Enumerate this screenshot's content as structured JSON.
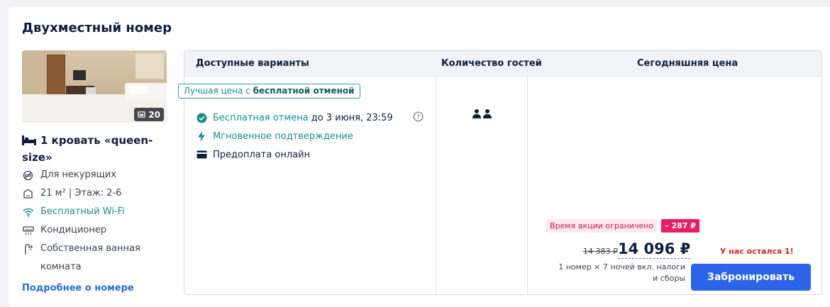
{
  "room": {
    "title": "Двухместный номер",
    "photo_count": "20",
    "bed": "1 кровать «queen-size»",
    "features": [
      {
        "icon": "no-smoking-icon",
        "label": "Для некурящих"
      },
      {
        "icon": "room-size-icon",
        "label": "21 м² | Этаж: 2-6"
      },
      {
        "icon": "wifi-icon",
        "label": "Бесплатный Wi-Fi"
      },
      {
        "icon": "air-conditioner-icon",
        "label": "Кондиционер"
      },
      {
        "icon": "shower-icon",
        "label": "Собственная ванная комната"
      }
    ],
    "more_link": "Подробнее о номере"
  },
  "table": {
    "headers": {
      "options": "Доступные варианты",
      "guests": "Количество гостей",
      "price": "Сегодняшняя цена"
    },
    "best_tag_prefix": "Лучшая цена с",
    "best_tag_bold": "бесплатной отменой",
    "options": {
      "free_cancel": "Бесплатная отмена",
      "free_cancel_until": "до 3 июня, 23:59",
      "instant_confirm": "Мгновенное подтверждение",
      "prepay": "Предоплата онлайн"
    },
    "price": {
      "promo_text": "Время акции ограничено",
      "discount": "– 287 ₽",
      "old": "14 383 ₽",
      "current": "14 096 ₽",
      "note": "1 номер × 7 ночей вкл. налоги и сборы",
      "left": "У нас остался 1!",
      "book": "Забронировать"
    }
  },
  "colors": {
    "accent": "#2c64e8",
    "teal": "#1a8c8c",
    "discount": "#e91e63"
  }
}
